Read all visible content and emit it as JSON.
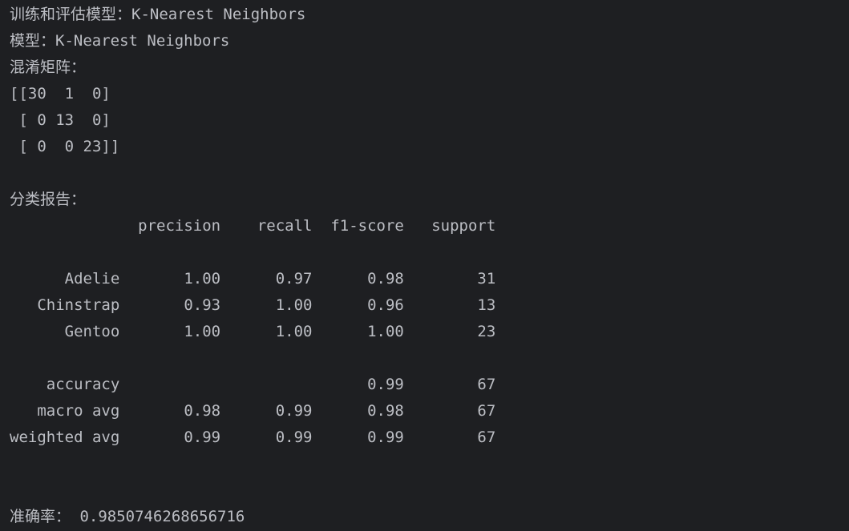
{
  "console": {
    "training_label": "训练和评估模型：",
    "training_model": "K-Nearest Neighbors",
    "model_label": "模型：",
    "model_name": "K-Nearest Neighbors",
    "confusion_matrix_label": "混淆矩阵：",
    "confusion_matrix_rows": [
      "[[30  1  0]",
      " [ 0 13  0]",
      " [ 0  0 23]]"
    ],
    "report_label": "分类报告：",
    "report_header": "              precision    recall  f1-score   support",
    "report_rows": [
      "      Adelie       1.00      0.97      0.98        31",
      "   Chinstrap       0.93      1.00      0.96        13",
      "      Gentoo       1.00      1.00      1.00        23",
      "    accuracy                           0.99        67",
      "   macro avg       0.98      0.99      0.98        67",
      "weighted avg       0.99      0.99      0.99        67"
    ],
    "accuracy_label": "准确率：",
    "accuracy_value": " 0.9850746268656716"
  }
}
